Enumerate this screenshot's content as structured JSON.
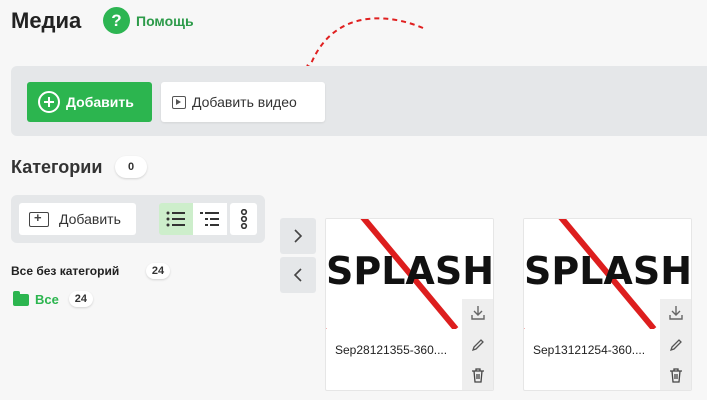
{
  "header": {
    "title": "Медиа",
    "help_label": "Помощь",
    "help_glyph": "?"
  },
  "toolbar": {
    "add_label": "Добавить",
    "add_video_label": "Добавить видео"
  },
  "categories": {
    "title": "Категории",
    "count": "0",
    "add_label": "Добавить",
    "uncategorized_label": "Все без категорий",
    "uncategorized_count": "24",
    "all_label": "Все",
    "all_count": "24"
  },
  "media": [
    {
      "name": "Sep28121355-360....",
      "thumb_text": "SPLASH"
    },
    {
      "name": "Sep13121254-360....",
      "thumb_text": "SPLASH"
    }
  ],
  "colors": {
    "accent": "#2cb54f",
    "toolbar_bg": "#e5e7e9",
    "active_view": "#cdeecb",
    "arrow": "#e02020"
  },
  "icons": {
    "help": "question-icon",
    "add": "plus-circle-icon",
    "video": "video-play-icon",
    "folder_add": "folder-plus-icon",
    "list_view": "list-view-icon",
    "tree_view": "tree-view-icon",
    "more": "more-vertical-icon",
    "folder": "folder-icon",
    "next": "chevron-right-icon",
    "prev": "chevron-left-icon",
    "download": "download-icon",
    "edit": "pencil-icon",
    "delete": "trash-icon"
  }
}
